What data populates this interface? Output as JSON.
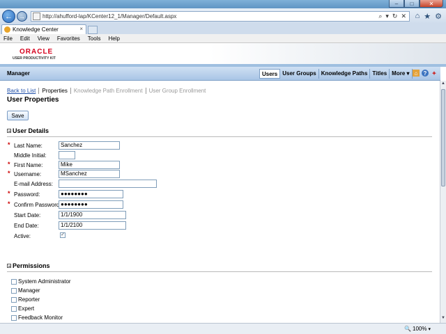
{
  "browser": {
    "address": "http://ahufford-lap/KCenter12_1/Manager/Default.aspx",
    "tab_title": "Knowledge Center",
    "tab_close": "×",
    "menu": [
      "File",
      "Edit",
      "View",
      "Favorites",
      "Tools",
      "Help"
    ],
    "zoom": "100%",
    "window_buttons": {
      "minimize": "–",
      "maximize": "□",
      "close": "✕"
    }
  },
  "app": {
    "logo_brand": "ORACLE",
    "logo_product": "USER PRODUCTIVITY KIT",
    "header_title": "Manager",
    "nav": [
      {
        "label": "Users",
        "active": true
      },
      {
        "label": "User Groups",
        "active": false
      },
      {
        "label": "Knowledge Paths",
        "active": false
      },
      {
        "label": "Titles",
        "active": false
      },
      {
        "label": "More",
        "active": false
      }
    ]
  },
  "breadcrumb": [
    "Back to List",
    "Properties",
    "Knowledge Path Enrollment",
    "User Group Enrollment"
  ],
  "page_title": "User Properties",
  "save_label": "Save",
  "user_details": {
    "section_title": "User Details",
    "fields": {
      "last_name": {
        "label": "Last Name:",
        "value": "Sanchez",
        "required": true
      },
      "middle_initial": {
        "label": "Middle Initial:",
        "value": "",
        "required": false
      },
      "first_name": {
        "label": "First Name:",
        "value": "Mike",
        "required": true
      },
      "username": {
        "label": "Username:",
        "value": "MSanchez",
        "required": true
      },
      "email": {
        "label": "E-mail Address:",
        "value": "",
        "required": false
      },
      "password": {
        "label": "Password:",
        "value": "●●●●●●●●",
        "required": true
      },
      "confirm_password": {
        "label": "Confirm Password:",
        "value": "●●●●●●●●",
        "required": true
      },
      "start_date": {
        "label": "Start Date:",
        "value": "1/1/1900",
        "required": false
      },
      "end_date": {
        "label": "End Date:",
        "value": "1/1/2100",
        "required": false
      },
      "active": {
        "label": "Active:",
        "checked": true,
        "mark": "✓"
      }
    },
    "required_mark": "*"
  },
  "permissions": {
    "section_title": "Permissions",
    "items": [
      {
        "label": "System Administrator",
        "checked": false
      },
      {
        "label": "Manager",
        "checked": false
      },
      {
        "label": "Reporter",
        "checked": false
      },
      {
        "label": "Expert",
        "checked": false
      },
      {
        "label": "Feedback Monitor",
        "checked": false
      }
    ]
  }
}
